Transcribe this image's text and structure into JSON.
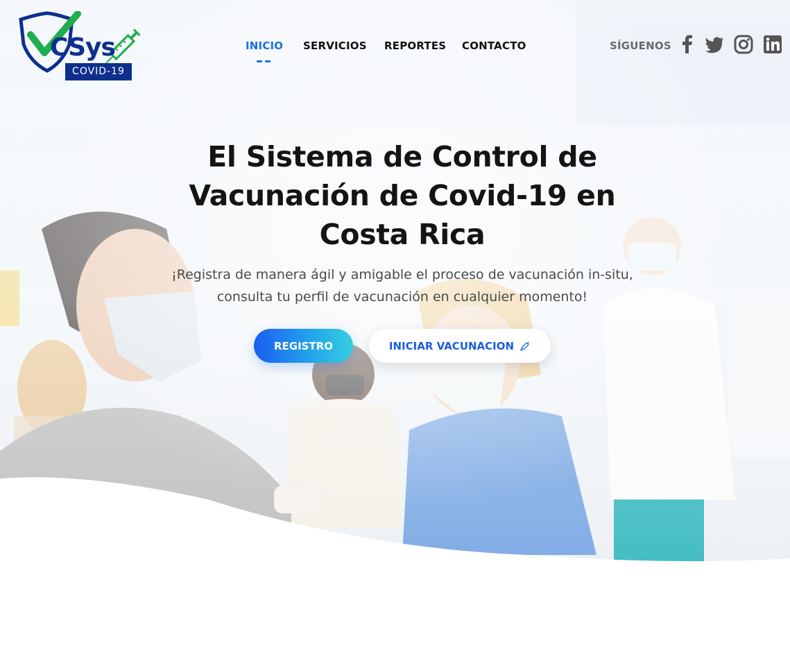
{
  "brand": {
    "logo_word": "CSys",
    "logo_badge": "COVID-19",
    "accent": "#1a6fe0",
    "dark_blue": "#0e2f8e",
    "green": "#1fae4b"
  },
  "nav": {
    "items": [
      {
        "label": "INICIO",
        "active": true
      },
      {
        "label": "SERVICIOS",
        "active": false
      },
      {
        "label": "REPORTES",
        "active": false
      },
      {
        "label": "CONTACTO",
        "active": false
      }
    ]
  },
  "social": {
    "label": "SÍGUENOS",
    "icons": [
      "facebook-icon",
      "twitter-icon",
      "instagram-icon",
      "linkedin-icon"
    ]
  },
  "hero": {
    "title_lines": [
      "El Sistema de Control de",
      "Vacunación de Covid-19 en",
      "Costa Rica"
    ],
    "subtitle_lines": [
      "¡Registra de manera ágil y amigable el proceso de vacunación in-situ,",
      "consulta tu perfil de vacunación en cualquier momento!"
    ],
    "primary_button": "REGISTRO",
    "secondary_button": "INICIAR VACUNACION",
    "secondary_icon": "syringe-icon"
  }
}
